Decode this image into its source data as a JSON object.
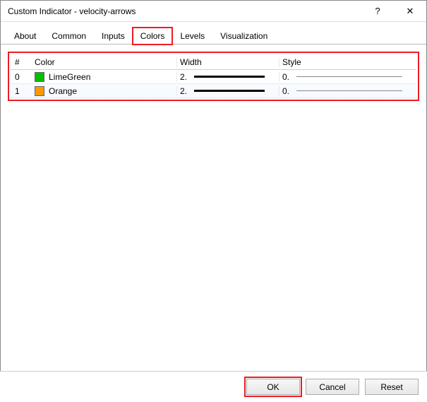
{
  "window": {
    "title": "Custom Indicator - velocity-arrows",
    "help_glyph": "?",
    "close_glyph": "✕"
  },
  "tabs": {
    "about": "About",
    "common": "Common",
    "inputs": "Inputs",
    "colors": "Colors",
    "levels": "Levels",
    "visualization": "Visualization"
  },
  "headers": {
    "idx": "#",
    "color": "Color",
    "width": "Width",
    "style": "Style"
  },
  "rows": [
    {
      "idx": "0",
      "color_name": "LimeGreen",
      "color_hex": "#00c000",
      "width": "2.",
      "style": "0."
    },
    {
      "idx": "1",
      "color_name": "Orange",
      "color_hex": "#ff9800",
      "width": "2.",
      "style": "0."
    }
  ],
  "buttons": {
    "ok": "OK",
    "cancel": "Cancel",
    "reset": "Reset"
  }
}
